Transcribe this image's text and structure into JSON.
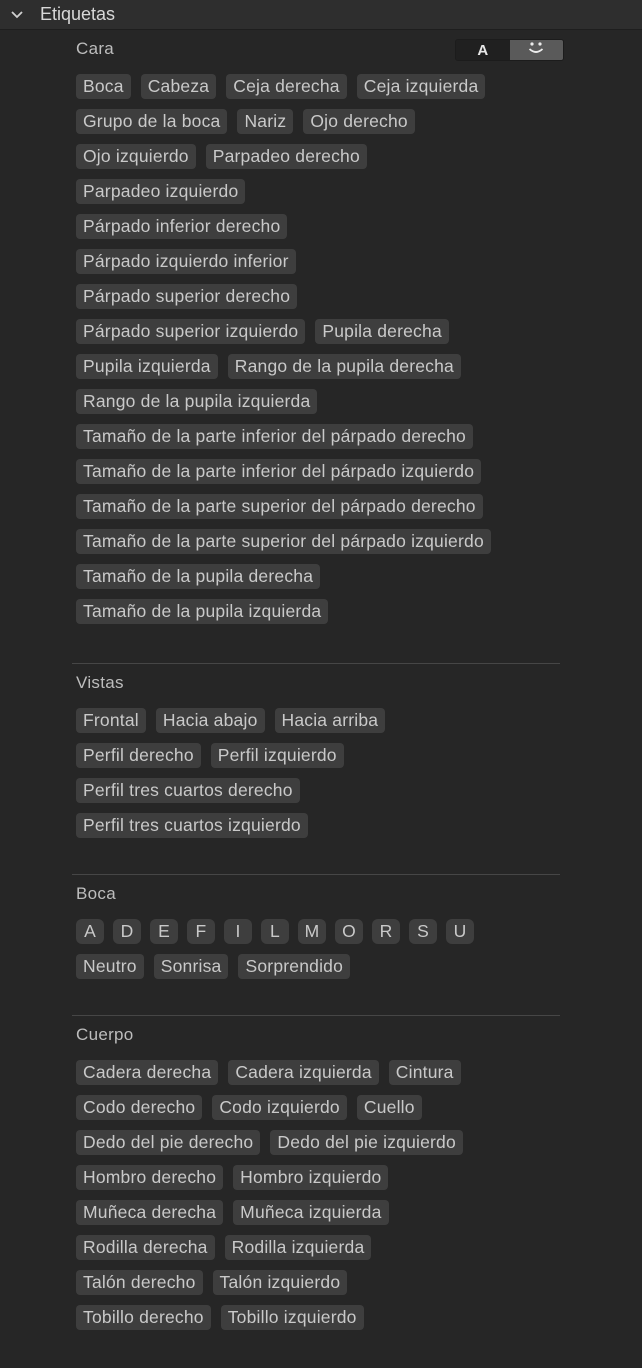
{
  "header": {
    "title": "Etiquetas"
  },
  "toggle": {
    "text_label": "A",
    "face_icon": "smiley-face-icon"
  },
  "sections": [
    {
      "title": "Cara",
      "rows": [
        [
          "Boca",
          "Cabeza",
          "Ceja derecha",
          "Ceja izquierda"
        ],
        [
          "Grupo de la boca",
          "Nariz",
          "Ojo derecho"
        ],
        [
          "Ojo izquierdo",
          "Parpadeo derecho"
        ],
        [
          "Parpadeo izquierdo"
        ],
        [
          "Párpado inferior derecho"
        ],
        [
          "Párpado izquierdo inferior"
        ],
        [
          "Párpado superior derecho"
        ],
        [
          "Párpado superior izquierdo",
          "Pupila derecha"
        ],
        [
          "Pupila izquierda",
          "Rango de la pupila derecha"
        ],
        [
          "Rango de la pupila izquierda"
        ],
        [
          "Tamaño de la parte inferior del párpado derecho"
        ],
        [
          "Tamaño de la parte inferior del párpado izquierdo"
        ],
        [
          "Tamaño de la parte superior del párpado derecho"
        ],
        [
          "Tamaño de la parte superior del párpado izquierdo"
        ],
        [
          "Tamaño de la pupila derecha"
        ],
        [
          "Tamaño de la pupila izquierda"
        ]
      ]
    },
    {
      "title": "Vistas",
      "rows": [
        [
          "Frontal",
          "Hacia abajo",
          "Hacia arriba"
        ],
        [
          "Perfil derecho",
          "Perfil izquierdo"
        ],
        [
          "Perfil tres cuartos derecho"
        ],
        [
          "Perfil tres cuartos izquierdo"
        ]
      ]
    },
    {
      "title": "Boca",
      "rows": [
        [
          "A",
          "D",
          "E",
          "F",
          "I",
          "L",
          "M",
          "O",
          "R",
          "S",
          "U"
        ],
        [
          "Neutro",
          "Sonrisa",
          "Sorprendido"
        ]
      ]
    },
    {
      "title": "Cuerpo",
      "rows": [
        [
          "Cadera derecha",
          "Cadera izquierda",
          "Cintura"
        ],
        [
          "Codo derecho",
          "Codo izquierdo",
          "Cuello"
        ],
        [
          "Dedo del pie derecho",
          "Dedo del pie izquierdo"
        ],
        [
          "Hombro derecho",
          "Hombro izquierdo"
        ],
        [
          "Muñeca derecha",
          "Muñeca izquierda"
        ],
        [
          "Rodilla derecha",
          "Rodilla izquierda"
        ],
        [
          "Talón derecho",
          "Talón izquierdo"
        ],
        [
          "Tobillo derecho",
          "Tobillo izquierdo"
        ]
      ]
    }
  ]
}
